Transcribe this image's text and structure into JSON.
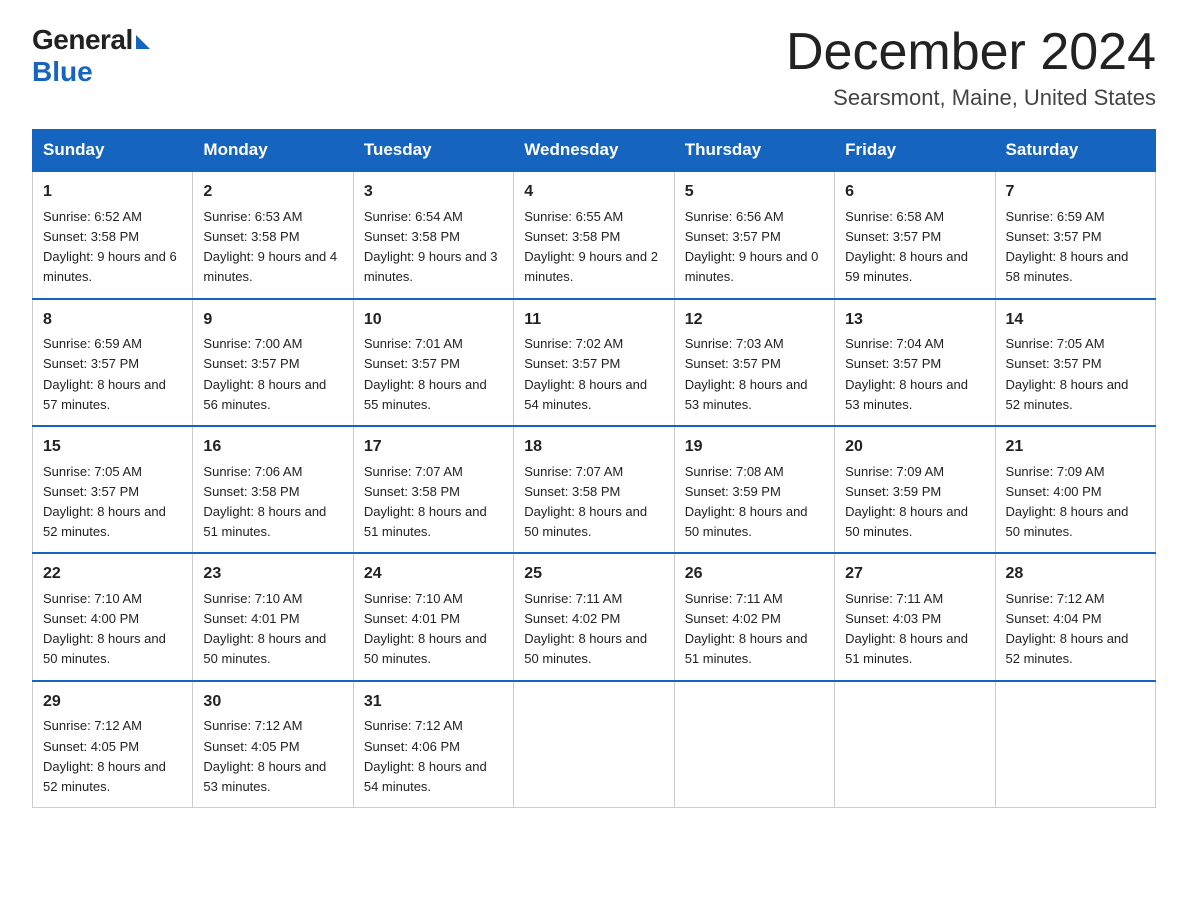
{
  "logo": {
    "general": "General",
    "blue": "Blue"
  },
  "title": "December 2024",
  "location": "Searsmont, Maine, United States",
  "days_of_week": [
    "Sunday",
    "Monday",
    "Tuesday",
    "Wednesday",
    "Thursday",
    "Friday",
    "Saturday"
  ],
  "weeks": [
    [
      {
        "day": "1",
        "sunrise": "Sunrise: 6:52 AM",
        "sunset": "Sunset: 3:58 PM",
        "daylight": "Daylight: 9 hours and 6 minutes."
      },
      {
        "day": "2",
        "sunrise": "Sunrise: 6:53 AM",
        "sunset": "Sunset: 3:58 PM",
        "daylight": "Daylight: 9 hours and 4 minutes."
      },
      {
        "day": "3",
        "sunrise": "Sunrise: 6:54 AM",
        "sunset": "Sunset: 3:58 PM",
        "daylight": "Daylight: 9 hours and 3 minutes."
      },
      {
        "day": "4",
        "sunrise": "Sunrise: 6:55 AM",
        "sunset": "Sunset: 3:58 PM",
        "daylight": "Daylight: 9 hours and 2 minutes."
      },
      {
        "day": "5",
        "sunrise": "Sunrise: 6:56 AM",
        "sunset": "Sunset: 3:57 PM",
        "daylight": "Daylight: 9 hours and 0 minutes."
      },
      {
        "day": "6",
        "sunrise": "Sunrise: 6:58 AM",
        "sunset": "Sunset: 3:57 PM",
        "daylight": "Daylight: 8 hours and 59 minutes."
      },
      {
        "day": "7",
        "sunrise": "Sunrise: 6:59 AM",
        "sunset": "Sunset: 3:57 PM",
        "daylight": "Daylight: 8 hours and 58 minutes."
      }
    ],
    [
      {
        "day": "8",
        "sunrise": "Sunrise: 6:59 AM",
        "sunset": "Sunset: 3:57 PM",
        "daylight": "Daylight: 8 hours and 57 minutes."
      },
      {
        "day": "9",
        "sunrise": "Sunrise: 7:00 AM",
        "sunset": "Sunset: 3:57 PM",
        "daylight": "Daylight: 8 hours and 56 minutes."
      },
      {
        "day": "10",
        "sunrise": "Sunrise: 7:01 AM",
        "sunset": "Sunset: 3:57 PM",
        "daylight": "Daylight: 8 hours and 55 minutes."
      },
      {
        "day": "11",
        "sunrise": "Sunrise: 7:02 AM",
        "sunset": "Sunset: 3:57 PM",
        "daylight": "Daylight: 8 hours and 54 minutes."
      },
      {
        "day": "12",
        "sunrise": "Sunrise: 7:03 AM",
        "sunset": "Sunset: 3:57 PM",
        "daylight": "Daylight: 8 hours and 53 minutes."
      },
      {
        "day": "13",
        "sunrise": "Sunrise: 7:04 AM",
        "sunset": "Sunset: 3:57 PM",
        "daylight": "Daylight: 8 hours and 53 minutes."
      },
      {
        "day": "14",
        "sunrise": "Sunrise: 7:05 AM",
        "sunset": "Sunset: 3:57 PM",
        "daylight": "Daylight: 8 hours and 52 minutes."
      }
    ],
    [
      {
        "day": "15",
        "sunrise": "Sunrise: 7:05 AM",
        "sunset": "Sunset: 3:57 PM",
        "daylight": "Daylight: 8 hours and 52 minutes."
      },
      {
        "day": "16",
        "sunrise": "Sunrise: 7:06 AM",
        "sunset": "Sunset: 3:58 PM",
        "daylight": "Daylight: 8 hours and 51 minutes."
      },
      {
        "day": "17",
        "sunrise": "Sunrise: 7:07 AM",
        "sunset": "Sunset: 3:58 PM",
        "daylight": "Daylight: 8 hours and 51 minutes."
      },
      {
        "day": "18",
        "sunrise": "Sunrise: 7:07 AM",
        "sunset": "Sunset: 3:58 PM",
        "daylight": "Daylight: 8 hours and 50 minutes."
      },
      {
        "day": "19",
        "sunrise": "Sunrise: 7:08 AM",
        "sunset": "Sunset: 3:59 PM",
        "daylight": "Daylight: 8 hours and 50 minutes."
      },
      {
        "day": "20",
        "sunrise": "Sunrise: 7:09 AM",
        "sunset": "Sunset: 3:59 PM",
        "daylight": "Daylight: 8 hours and 50 minutes."
      },
      {
        "day": "21",
        "sunrise": "Sunrise: 7:09 AM",
        "sunset": "Sunset: 4:00 PM",
        "daylight": "Daylight: 8 hours and 50 minutes."
      }
    ],
    [
      {
        "day": "22",
        "sunrise": "Sunrise: 7:10 AM",
        "sunset": "Sunset: 4:00 PM",
        "daylight": "Daylight: 8 hours and 50 minutes."
      },
      {
        "day": "23",
        "sunrise": "Sunrise: 7:10 AM",
        "sunset": "Sunset: 4:01 PM",
        "daylight": "Daylight: 8 hours and 50 minutes."
      },
      {
        "day": "24",
        "sunrise": "Sunrise: 7:10 AM",
        "sunset": "Sunset: 4:01 PM",
        "daylight": "Daylight: 8 hours and 50 minutes."
      },
      {
        "day": "25",
        "sunrise": "Sunrise: 7:11 AM",
        "sunset": "Sunset: 4:02 PM",
        "daylight": "Daylight: 8 hours and 50 minutes."
      },
      {
        "day": "26",
        "sunrise": "Sunrise: 7:11 AM",
        "sunset": "Sunset: 4:02 PM",
        "daylight": "Daylight: 8 hours and 51 minutes."
      },
      {
        "day": "27",
        "sunrise": "Sunrise: 7:11 AM",
        "sunset": "Sunset: 4:03 PM",
        "daylight": "Daylight: 8 hours and 51 minutes."
      },
      {
        "day": "28",
        "sunrise": "Sunrise: 7:12 AM",
        "sunset": "Sunset: 4:04 PM",
        "daylight": "Daylight: 8 hours and 52 minutes."
      }
    ],
    [
      {
        "day": "29",
        "sunrise": "Sunrise: 7:12 AM",
        "sunset": "Sunset: 4:05 PM",
        "daylight": "Daylight: 8 hours and 52 minutes."
      },
      {
        "day": "30",
        "sunrise": "Sunrise: 7:12 AM",
        "sunset": "Sunset: 4:05 PM",
        "daylight": "Daylight: 8 hours and 53 minutes."
      },
      {
        "day": "31",
        "sunrise": "Sunrise: 7:12 AM",
        "sunset": "Sunset: 4:06 PM",
        "daylight": "Daylight: 8 hours and 54 minutes."
      },
      null,
      null,
      null,
      null
    ]
  ]
}
